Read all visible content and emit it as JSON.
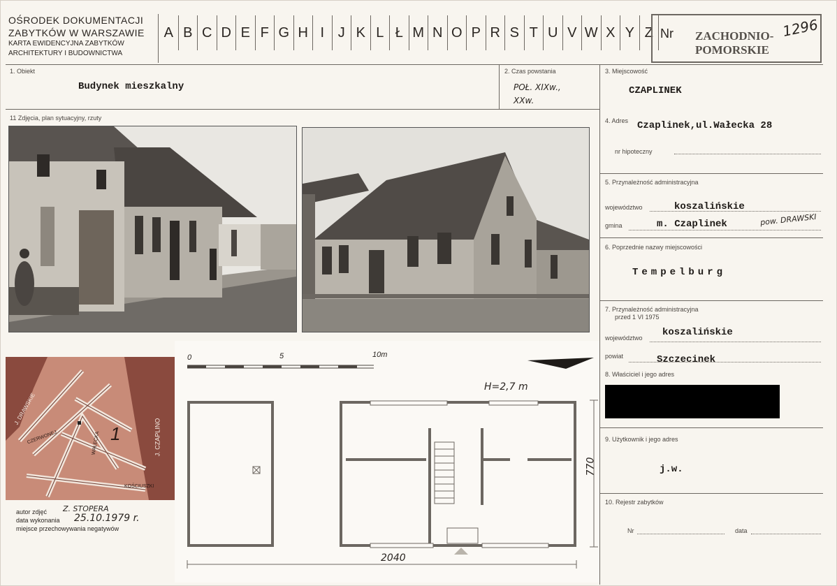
{
  "header": {
    "institution_line1": "OŚRODEK DOKUMENTACJI",
    "institution_line2": "ZABYTKÓW W WARSZAWIE",
    "institution_line3": "KARTA EWIDENCYJNA ZABYTKÓW",
    "institution_line4": "ARCHITEKTURY I BUDOWNICTWA",
    "letters": [
      "A",
      "B",
      "C",
      "D",
      "E",
      "F",
      "G",
      "H",
      "I",
      "J",
      "K",
      "L",
      "Ł",
      "M",
      "N",
      "O",
      "P",
      "R",
      "S",
      "T",
      "U",
      "V",
      "W",
      "X",
      "Y",
      "Z"
    ],
    "nr_label": "Nr",
    "region_line1": "ZACHODNIO-",
    "region_line2": "POMORSKIE",
    "number": "1296"
  },
  "fields": {
    "obiekt_label": "1. Obiekt",
    "obiekt_value": "Budynek mieszkalny",
    "czas_label": "2. Czas powstania",
    "czas_value_line1": "POŁ. XIXw.,",
    "czas_value_line2": "XXw.",
    "miejscowosc_label": "3. Miejscowość",
    "miejscowosc_value": "CZAPLINEK",
    "zdjecia_label": "11 Zdjęcia, plan sytuacyjny, rzuty",
    "adres_label": "4. Adres",
    "adres_value": "Czaplinek,ul.Wałecka 28",
    "hipoteczny_label": "nr hipoteczny",
    "przynaleznosc_label": "5. Przynależność administracyjna",
    "wojewodztwo_label": "województwo",
    "wojewodztwo_value": "koszalińskie",
    "gmina_label": "gmina",
    "gmina_value": "m. Czaplinek",
    "gmina_hand": "pow. DRAWSKI",
    "poprzednie_label": "6. Poprzednie nazwy miejscowości",
    "poprzednie_value": "Tempelburg",
    "przynaleznosc1975_label_line1": "7. Przynależność administracyjna",
    "przynaleznosc1975_label_line2": "przed 1 VI 1975",
    "woj1975_label": "województwo",
    "woj1975_value": "koszalińskie",
    "powiat_label": "powiat",
    "powiat_value": "Szczecinek",
    "wlasciciel_label": "8. Właściciel i jego adres",
    "uzytkownik_label": "9. Użytkownik i jego adres",
    "uzytkownik_value": "j.w.",
    "rejestr_label": "10. Rejestr zabytków",
    "rejestr_nr_label": "Nr",
    "rejestr_data_label": "data"
  },
  "photo_credits": {
    "autor_label": "autor zdjęć",
    "autor_value": "Z. STOPERA",
    "data_label": "data wykonania",
    "data_value": "25.10.1979 r.",
    "miejsce_label": "miejsce przechowywania negatywów"
  },
  "map": {
    "labels": [
      "J. DRAWSKIE",
      "J. CZAPLINO",
      "WAŁECKA",
      "1",
      "CZERWONEJ",
      "KOŚCIUSZKI"
    ]
  },
  "plan": {
    "scale_0": "0",
    "scale_5": "5",
    "scale_10": "10m",
    "height_note": "H=2,7 m",
    "dim_bottom": "2040",
    "dim_right": "770"
  },
  "colors": {
    "map_bg": "#c88b78",
    "map_dark": "#8a4a3e",
    "redaction": "#000000"
  }
}
